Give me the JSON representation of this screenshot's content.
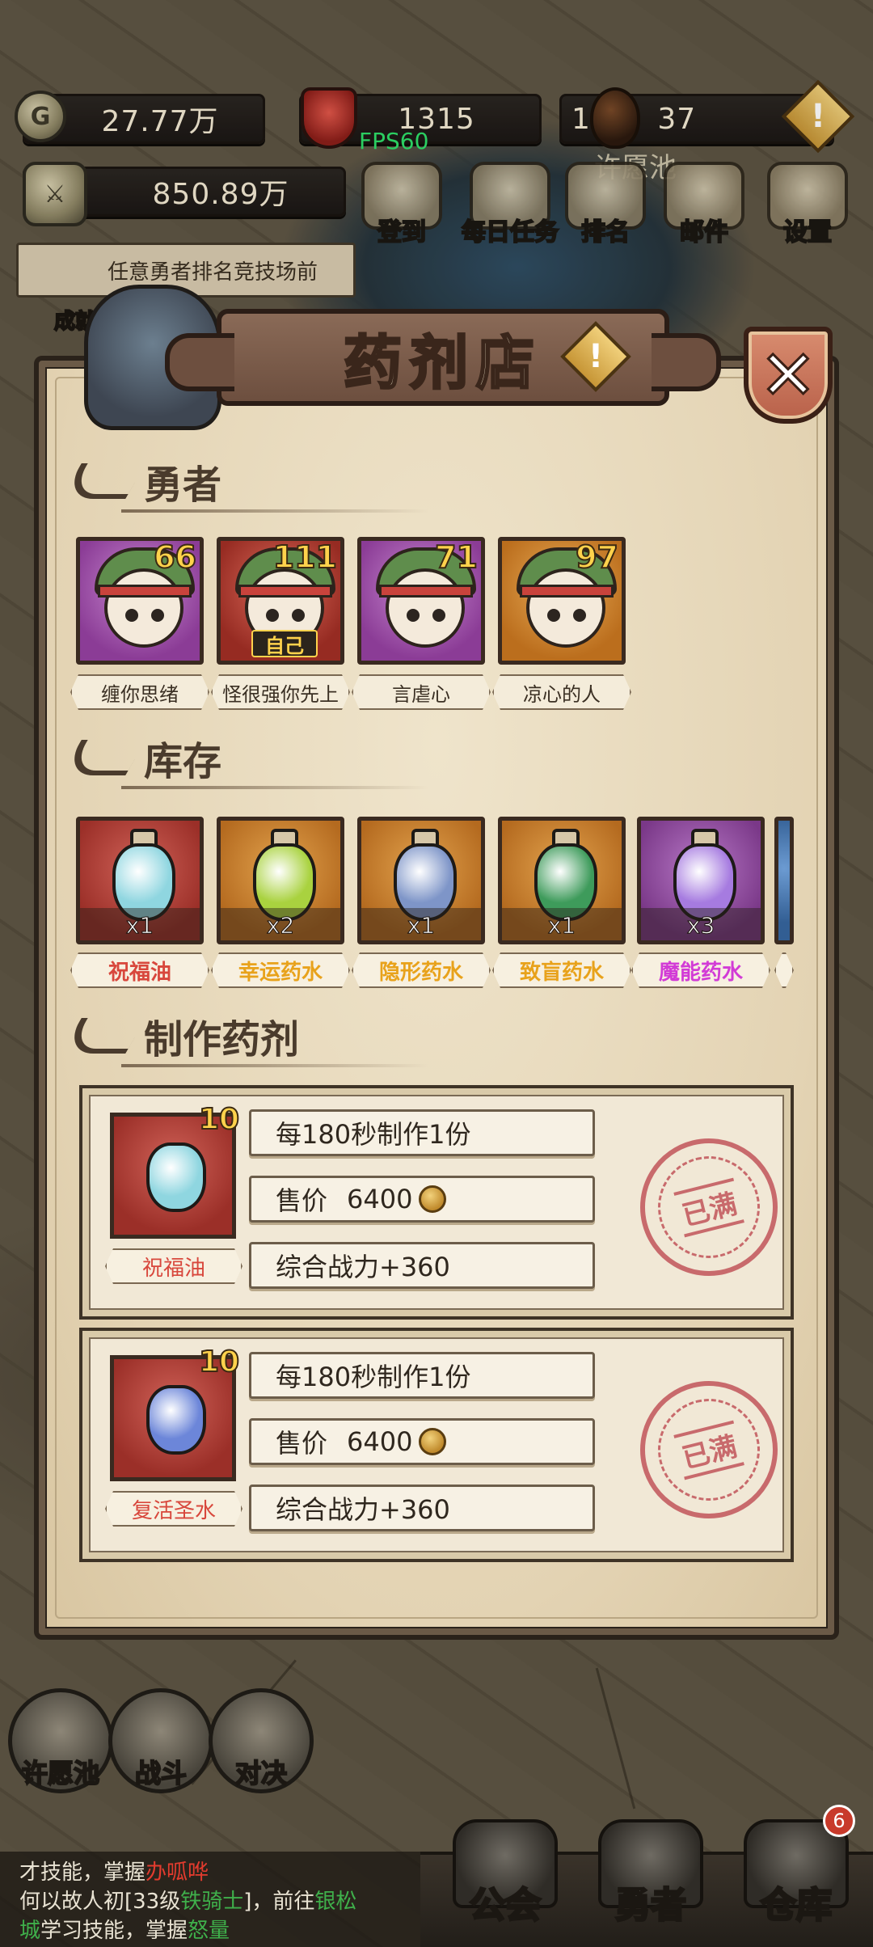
{
  "hud": {
    "gold": "27.77万",
    "gems": "1315",
    "fps": "FPS60",
    "eggs_prefix": "1,",
    "eggs": "37",
    "wish_pool_label": "许愿池",
    "power": "850.89万",
    "buttons": [
      {
        "label": "登到",
        "icon": "scroll-icon"
      },
      {
        "label": "每日任务",
        "icon": "quest-icon"
      },
      {
        "label": "排名",
        "icon": "trophy-icon"
      },
      {
        "label": "邮件",
        "icon": "mail-icon"
      },
      {
        "label": "设置",
        "icon": "gear-icon"
      }
    ],
    "achievement_text": "任意勇者排名竞技场前",
    "achievement_label": "成就"
  },
  "modal": {
    "title": "药剂店",
    "close_glyph": "✕",
    "sections": {
      "heroes": "勇者",
      "inventory": "库存",
      "craft": "制作药剂"
    },
    "heroes": [
      {
        "name": "缠你思绪",
        "level": "66",
        "frame": "purple",
        "self": ""
      },
      {
        "name": "怪很强你先上",
        "level": "111",
        "frame": "red",
        "self": "自己"
      },
      {
        "name": "言虐心",
        "level": "71",
        "frame": "purple",
        "self": ""
      },
      {
        "name": "凉心的人",
        "level": "97",
        "frame": "orange",
        "self": ""
      }
    ],
    "inventory": [
      {
        "name": "祝福油",
        "qty": "x1",
        "frame": "red",
        "color": "#d8473c",
        "liquid": "#8fd6e0"
      },
      {
        "name": "幸运药水",
        "qty": "x2",
        "frame": "orange",
        "color": "#e8a21b",
        "liquid": "#a9d23f"
      },
      {
        "name": "隐形药水",
        "qty": "x1",
        "frame": "orange",
        "color": "#e8a21b",
        "liquid": "#7e95c8"
      },
      {
        "name": "致盲药水",
        "qty": "x1",
        "frame": "orange",
        "color": "#e8a21b",
        "liquid": "#3e9b5b"
      },
      {
        "name": "魔能药水",
        "qty": "x3",
        "frame": "purple",
        "color": "#d23bd6",
        "liquid": "#a67be0"
      }
    ],
    "recipes": [
      {
        "name": "祝福油",
        "level": "10",
        "rate": "每180秒制作1份",
        "price_label": "售价",
        "price": "6400",
        "power": "综合战力+360",
        "status": "已满",
        "liquid": "#8fd6e0"
      },
      {
        "name": "复活圣水",
        "level": "10",
        "rate": "每180秒制作1份",
        "price_label": "售价",
        "price": "6400",
        "power": "综合战力+360",
        "status": "已满",
        "liquid": "#6c86d9"
      }
    ]
  },
  "bottom": {
    "circle_buttons": [
      {
        "label": "许愿池",
        "icon": "fountain-icon"
      },
      {
        "label": "战斗",
        "icon": "swords-icon"
      },
      {
        "label": "对决",
        "icon": "fist-icon"
      }
    ],
    "chat_line1_prefix": "才技能，掌握",
    "chat_line1_red": "办呱哗",
    "chat_line2_a": "何以故人初[33级",
    "chat_line2_green": "铁骑士",
    "chat_line2_b": "]，前往",
    "chat_line2_green2": "银松",
    "chat_line3_green": "城",
    "chat_line3_b": "学习技能，掌握",
    "chat_line3_green3": "怒量",
    "nav": [
      {
        "label": "公会",
        "icon": "guild-icon"
      },
      {
        "label": "勇者",
        "icon": "helmet-icon"
      },
      {
        "label": "仓库",
        "icon": "warehouse-icon"
      }
    ],
    "warehouse_badge": "6"
  }
}
